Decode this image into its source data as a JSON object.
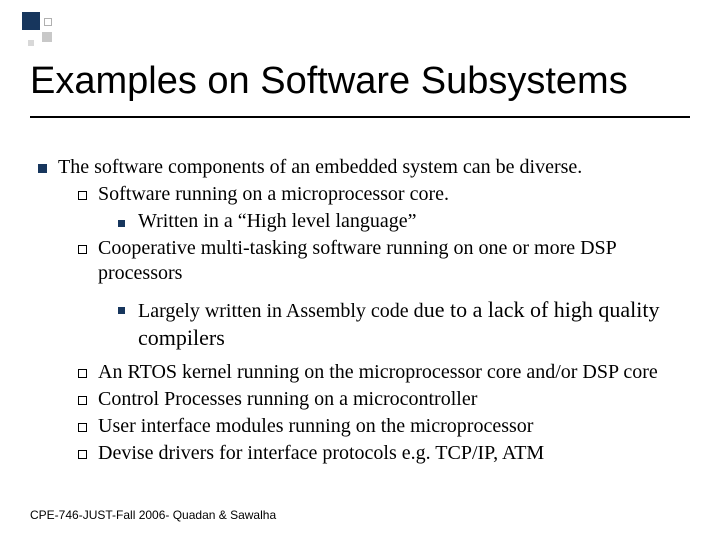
{
  "title": "Examples on Software Subsystems",
  "intro": "The software components of an embedded system can be diverse.",
  "sub1": "Software running on a microprocessor core.",
  "sub1a": "Written in a “High level language”",
  "sub2": "Cooperative multi-tasking software running on one or more DSP processors",
  "sub2a_prefix": "Largely written in Assembly code d",
  "sub2a_large": "ue to a lack of high quality compilers",
  "sub3": "An RTOS kernel running on the microprocessor core and/or DSP core",
  "sub4": "Control Processes running on a microcontroller",
  "sub5": "User interface modules running on the microprocessor",
  "sub6": "Devise drivers for interface protocols e.g. TCP/IP, ATM",
  "footer": "CPE-746-JUST-Fall 2006- Quadan & Sawalha"
}
